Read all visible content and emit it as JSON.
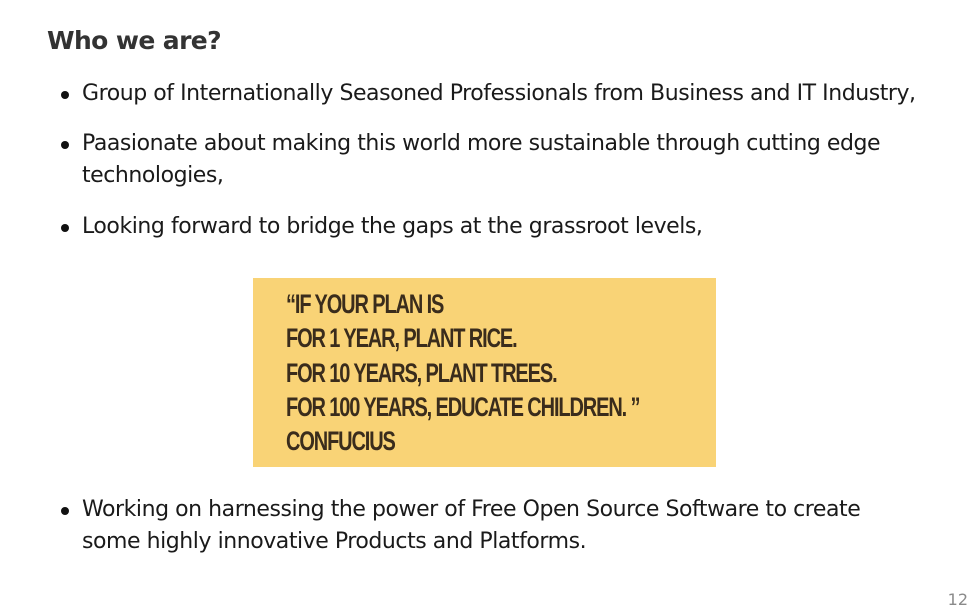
{
  "slide": {
    "title": "Who we are?",
    "bullets": [
      "Group of Internationally Seasoned Professionals from Business and IT Industry,",
      "Paasionate about making this world more sustainable through cutting edge technologies,",
      "Looking forward to bridge the gaps at the grassroot levels,",
      "Working on harnessing the power of Free Open Source Software to create some highly innovative Products and Platforms."
    ],
    "quote": {
      "lines": [
        "“IF YOUR PLAN IS",
        "FOR 1 YEAR, PLANT RICE.",
        "FOR 10 YEARS, PLANT TREES.",
        "FOR 100 YEARS, EDUCATE CHILDREN. ”",
        "CONFUCIUS"
      ],
      "background_color": "#f9d376",
      "text_color": "#3a2c1c"
    },
    "page_number": "12"
  }
}
